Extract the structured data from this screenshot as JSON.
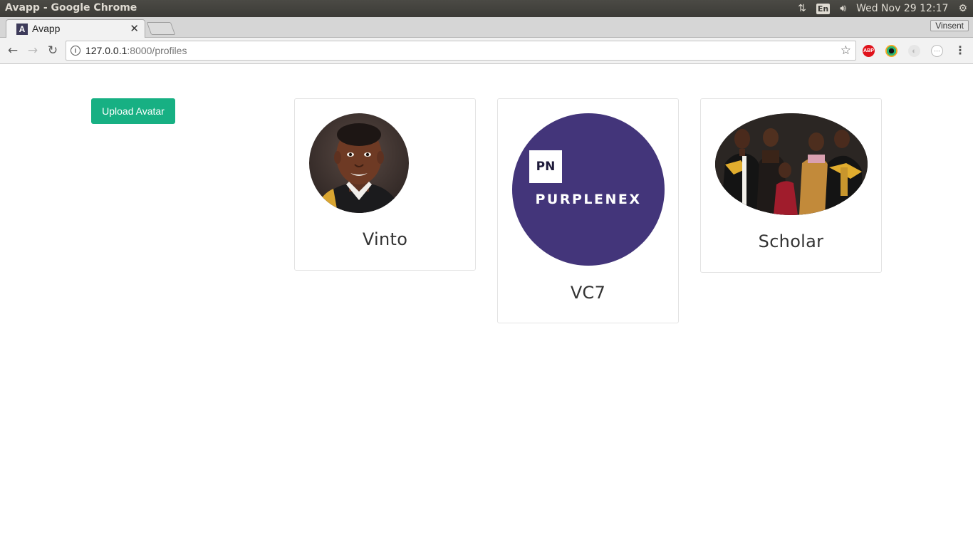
{
  "os_panel": {
    "window_title": "Avapp - Google Chrome",
    "lang_indicator": "En",
    "datetime": "Wed Nov 29 12:17"
  },
  "browser": {
    "tab_title": "Avapp",
    "tab_favicon_letter": "A",
    "profile_name": "Vinsent",
    "url_host": "127.0.0.1",
    "url_rest": ":8000/profiles",
    "extensions": [
      "ABP",
      "color-picker",
      "extension-3",
      "extension-4"
    ]
  },
  "page": {
    "upload_button_label": "Upload Avatar",
    "accent_color": "#17b083",
    "profiles": [
      {
        "name": "Vinto",
        "avatar_desc": "portrait-photo"
      },
      {
        "name": "VC7",
        "avatar_logo_mark": "PN",
        "avatar_logo_text": "PURPLENEX",
        "avatar_bg": "#43357a"
      },
      {
        "name": "Scholar",
        "avatar_desc": "graduation-family-photo"
      }
    ]
  }
}
